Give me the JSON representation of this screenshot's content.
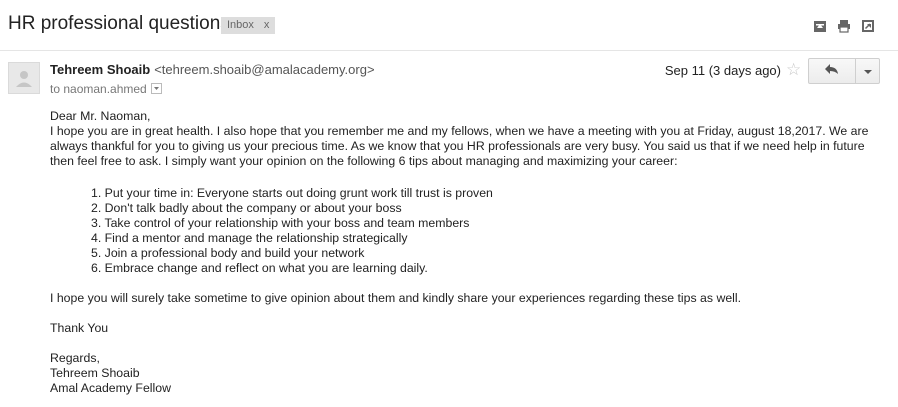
{
  "email": {
    "subject": "HR professional questions",
    "label": "Inbox",
    "label_close": "x",
    "sender_name": "Tehreem Shoaib",
    "sender_email": "<tehreem.shoaib@amalacademy.org>",
    "to": "to naoman.ahmed",
    "date": "Sep 11 (3 days ago)",
    "greeting": "Dear Mr. Naoman,",
    "intro": "I hope you are in great health. I also hope that you remember me and my fellows, when we have a meeting with you at Friday, august 18,2017. We are always thankful for you to giving us your precious time. As we know that you HR professionals are very busy. You said us that if we need help in future then feel free to ask. I simply want your opinion on the following 6 tips about managing and maximizing your career:",
    "tips": [
      "1. Put your time in: Everyone starts out doing grunt work till trust is proven",
      "2. Don't talk badly about the company or about your boss",
      "3. Take control of your relationship with your boss and team members",
      "4. Find a mentor and manage the relationship strategically",
      "5. Join a professional body and build your network",
      "6. Embrace change and reflect on what you are learning daily."
    ],
    "closing_request": "I hope you will surely take sometime to give opinion about them and kindly share your experiences regarding these tips as well.",
    "thanks": "Thank You",
    "regards": "Regards,",
    "signature_name": "Tehreem Shoaib",
    "signature_title": "Amal Academy Fellow"
  },
  "icons": {
    "archive": "archive-icon",
    "print": "print-icon",
    "new_window": "new-window-icon",
    "star": "star-icon",
    "reply": "reply-icon",
    "more": "chevron-down-icon",
    "avatar": "avatar-icon"
  },
  "colors": {
    "label_bg": "#dddddd",
    "text": "#222222",
    "muted": "#777777"
  }
}
